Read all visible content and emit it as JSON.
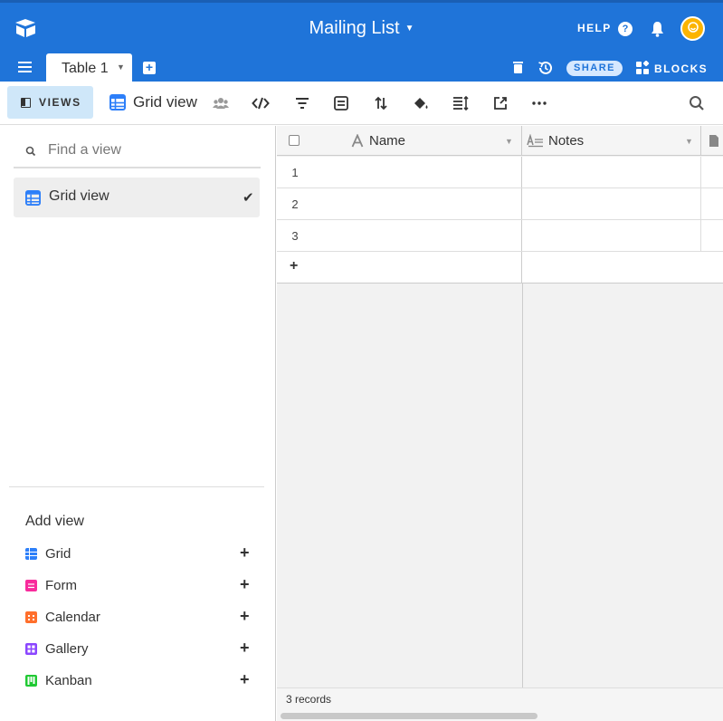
{
  "header": {
    "base_title": "Mailing List",
    "help_label": "HELP",
    "share_label": "SHARE",
    "blocks_label": "BLOCKS",
    "table_tab": "Table 1",
    "accent_color": "#1f74d9"
  },
  "viewbar": {
    "views_label": "VIEWS",
    "current_view": "Grid view"
  },
  "sidebar": {
    "find_placeholder": "Find a view",
    "views": [
      {
        "label": "Grid view",
        "selected": true
      }
    ],
    "add_view_title": "Add view",
    "add_view_items": [
      {
        "label": "Grid",
        "color": "#2d7ff9"
      },
      {
        "label": "Form",
        "color": "#f82b9c"
      },
      {
        "label": "Calendar",
        "color": "#ff6f2c"
      },
      {
        "label": "Gallery",
        "color": "#8b46ff"
      },
      {
        "label": "Kanban",
        "color": "#20c933"
      }
    ]
  },
  "grid": {
    "columns": [
      "Name",
      "Notes"
    ],
    "rows": [
      {
        "num": "1",
        "name": "",
        "notes": ""
      },
      {
        "num": "2",
        "name": "",
        "notes": ""
      },
      {
        "num": "3",
        "name": "",
        "notes": ""
      }
    ],
    "add_row_symbol": "+",
    "record_count": "3 records"
  }
}
